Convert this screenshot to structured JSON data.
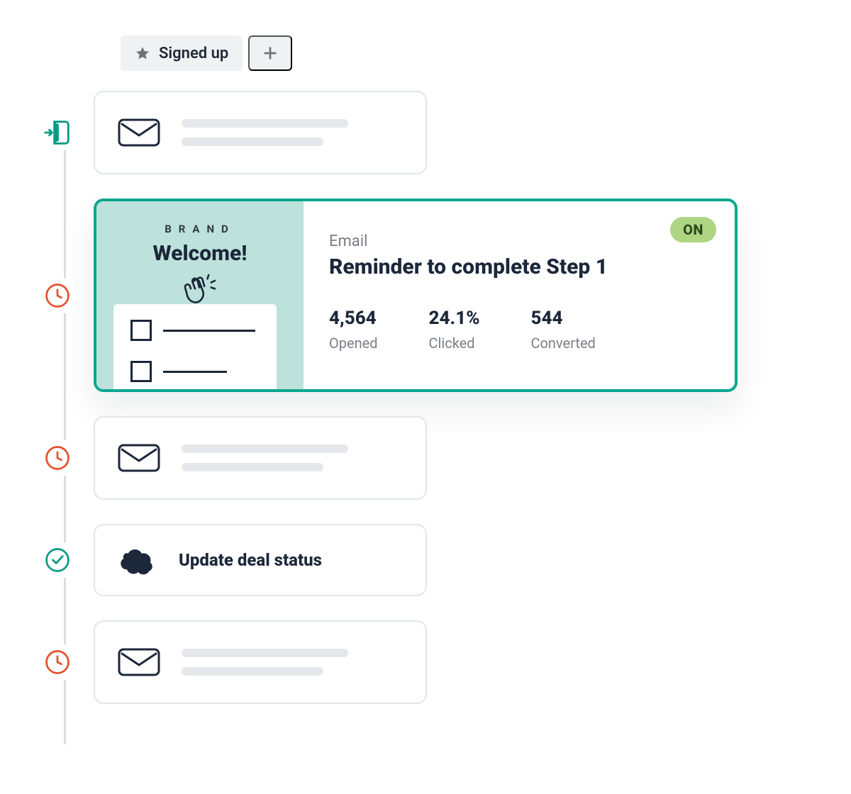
{
  "header": {
    "segment_label": "Signed up"
  },
  "timeline": {
    "big_card": {
      "preview": {
        "brand": "BRAND",
        "headline": "Welcome!"
      },
      "status": "ON",
      "type": "Email",
      "title": "Reminder to complete Step 1",
      "stats": [
        {
          "value": "4,564",
          "label": "Opened"
        },
        {
          "value": "24.1%",
          "label": "Clicked"
        },
        {
          "value": "544",
          "label": "Converted"
        }
      ]
    },
    "action": {
      "label": "Update deal status"
    }
  },
  "colors": {
    "teal": "#059B84",
    "red": "#E2522B",
    "badge": "#AED581"
  }
}
